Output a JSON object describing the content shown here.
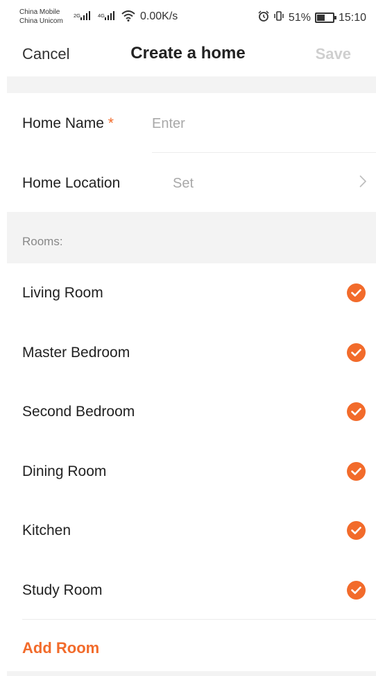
{
  "status_bar": {
    "carrier1": "China Mobile",
    "carrier2": "China Unicom",
    "sig1": "2G",
    "sig2": "4G",
    "speed": "0.00K/s",
    "battery": "51%",
    "time": "15:10"
  },
  "nav": {
    "cancel_label": "Cancel",
    "title": "Create a home",
    "save_label": "Save"
  },
  "form": {
    "home_name_label": "Home Name",
    "required_mark": "*",
    "home_name_placeholder": "Enter",
    "home_location_label": "Home Location",
    "home_location_value": "Set"
  },
  "rooms": {
    "section_label": "Rooms:",
    "items": [
      {
        "label": "Living Room",
        "checked": true
      },
      {
        "label": "Master Bedroom",
        "checked": true
      },
      {
        "label": "Second Bedroom",
        "checked": true
      },
      {
        "label": "Dining Room",
        "checked": true
      },
      {
        "label": "Kitchen",
        "checked": true
      },
      {
        "label": "Study Room",
        "checked": true
      }
    ],
    "add_label": "Add Room"
  },
  "colors": {
    "accent": "#f26b2b",
    "section_bg": "#f3f3f3"
  }
}
